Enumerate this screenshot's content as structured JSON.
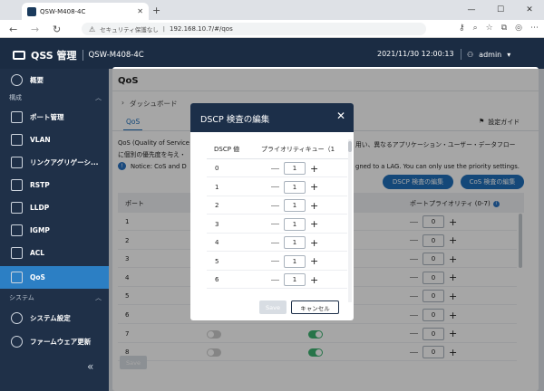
{
  "browser": {
    "tab_title": "QSW-M408-4C",
    "security_text": "セキュリティ保護なし",
    "url": "192.168.10.7/#/qos"
  },
  "header": {
    "brand": "QSS 管理",
    "model": "QSW-M408-4C",
    "datetime": "2021/11/30  12:00:13",
    "user": "admin"
  },
  "sidebar": {
    "overview": "概要",
    "group_config": "構成",
    "items": [
      {
        "label": "ポート管理",
        "icon": "port-icon"
      },
      {
        "label": "VLAN",
        "icon": "vlan-icon"
      },
      {
        "label": "リンクアグリゲーシ...",
        "icon": "link-aggregation-icon"
      },
      {
        "label": "RSTP",
        "icon": "rstp-icon"
      },
      {
        "label": "LLDP",
        "icon": "lldp-icon"
      },
      {
        "label": "IGMP",
        "icon": "igmp-icon"
      },
      {
        "label": "ACL",
        "icon": "acl-icon"
      },
      {
        "label": "QoS",
        "icon": "qos-icon"
      }
    ],
    "group_system": "システム",
    "system_items": [
      {
        "label": "システム設定",
        "icon": "gear-icon"
      },
      {
        "label": "ファームウェア更新",
        "icon": "firmware-icon"
      }
    ],
    "active_color": "#2c7fc4"
  },
  "main": {
    "title": "QoS",
    "dashboard_label": "ダッシュボード",
    "setting_guide": "設定ガイド",
    "tab_qos": "QoS",
    "desc_line1_left": "QoS (Quality of Service",
    "desc_line1_right": "用い、異なるアプリケーション・ユーザー・データフロー",
    "desc_line2": "に個別の優先度を与え・",
    "notice_left": "Notice: CoS and D",
    "notice_right": "gned to a LAG. You can only use the priority settings.",
    "btn_dscp": "DSCP 検査の編集",
    "btn_cos": "CoS 検査の編集",
    "col_port": "ポート",
    "col_priority": "ポートプライオリティ (0-7)",
    "ports": [
      {
        "port": "1",
        "priority": "0"
      },
      {
        "port": "2",
        "priority": "0"
      },
      {
        "port": "3",
        "priority": "0"
      },
      {
        "port": "4",
        "priority": "0"
      },
      {
        "port": "5",
        "priority": "0"
      },
      {
        "port": "6",
        "priority": "0"
      },
      {
        "port": "7",
        "priority": "0",
        "toggle1": "off",
        "toggle2": "on"
      },
      {
        "port": "8",
        "priority": "0",
        "toggle1": "off",
        "toggle2": "on"
      }
    ],
    "save_label": "Save"
  },
  "modal": {
    "title": "DSCP  検査の編集",
    "col_dscp": "DSCP 値",
    "col_queue": "プライオリティキュー（1",
    "rows": [
      {
        "dscp": "0",
        "queue": "1"
      },
      {
        "dscp": "1",
        "queue": "1"
      },
      {
        "dscp": "2",
        "queue": "1"
      },
      {
        "dscp": "3",
        "queue": "1"
      },
      {
        "dscp": "4",
        "queue": "1"
      },
      {
        "dscp": "5",
        "queue": "1"
      },
      {
        "dscp": "6",
        "queue": "1"
      }
    ],
    "save_label": "Save",
    "cancel_label": "キャンセル"
  }
}
